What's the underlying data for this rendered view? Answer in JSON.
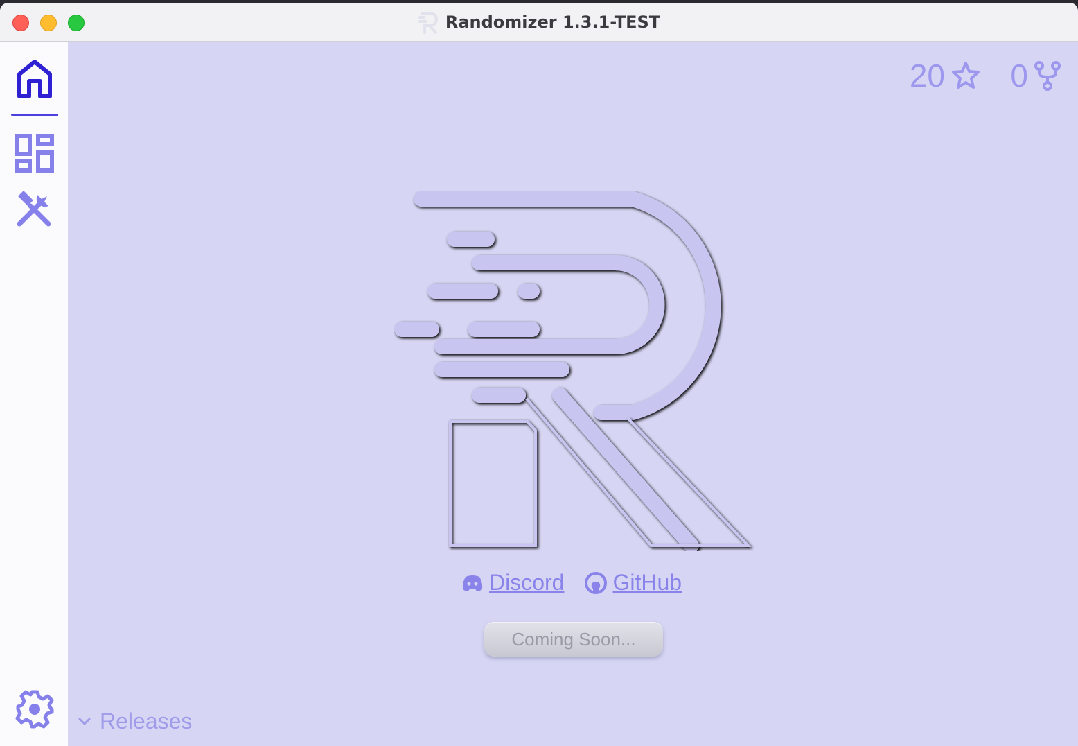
{
  "window": {
    "title": "Randomizer 1.3.1-TEST",
    "traffic_lights": [
      "close",
      "minimize",
      "zoom"
    ]
  },
  "sidebar": {
    "items": [
      {
        "icon": "home-icon",
        "active": true
      },
      {
        "icon": "dashboard-icon",
        "active": false
      },
      {
        "icon": "tools-icon",
        "active": false
      }
    ],
    "footer_icon": "gear-icon"
  },
  "stats": {
    "stars": "20",
    "forks": "0"
  },
  "links": {
    "discord": "Discord",
    "github": "GitHub"
  },
  "coming_soon_label": "Coming Soon...",
  "releases_label": "Releases",
  "colors": {
    "accent": "#4b3fe0",
    "background": "#d6d6f4",
    "muted_accent": "#9d98ee"
  }
}
